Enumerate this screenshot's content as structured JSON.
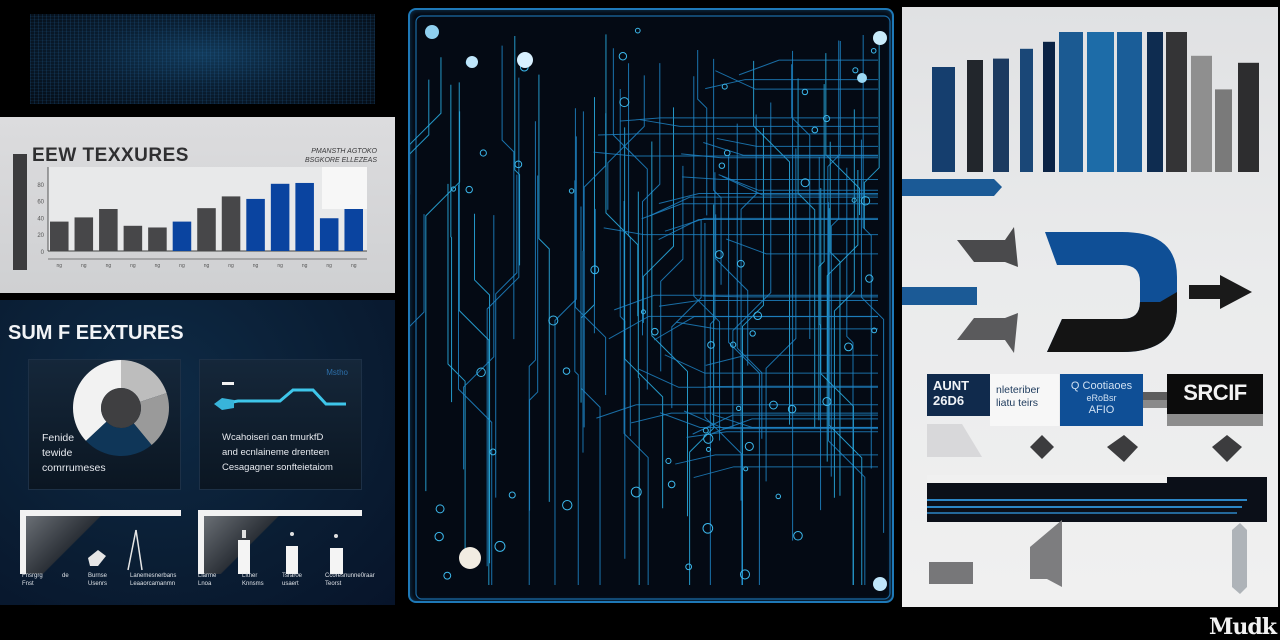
{
  "colors": {
    "accent_blue": "#0f4f96",
    "chart_blue": "#0a44a0",
    "chart_gray": "#474749",
    "circuit_trace": "#1e78b6",
    "circuit_bg": "#040a14",
    "dark_panel": "#0a1d33"
  },
  "banner": {
    "icon": "matrix-texture"
  },
  "chart_panel": {
    "title": "EEW TEXXURES",
    "legend_line1": "PMANSTH AGTOKO",
    "legend_line2": "BSGKORE ELLEZEAS"
  },
  "chart_data": {
    "type": "bar",
    "title": "EEW TEXXURES",
    "xlabel": "",
    "ylabel": "",
    "categories": [
      "ng",
      "ng",
      "ng",
      "ng",
      "ng",
      "ng",
      "ng",
      "ng",
      "ng",
      "ng",
      "ng",
      "ng",
      "ng"
    ],
    "y_tick_labels": [
      "0",
      "20",
      "40",
      "60",
      "80"
    ],
    "ylim": [
      0,
      100
    ],
    "series": [
      {
        "name": "gray",
        "color": "#474749",
        "values": [
          35,
          null,
          50,
          30,
          28,
          null,
          51,
          65,
          null,
          null,
          null,
          null,
          null
        ]
      },
      {
        "name": "blue",
        "color": "#0a44a0",
        "values": [
          null,
          null,
          null,
          null,
          null,
          35,
          null,
          null,
          62,
          80,
          81,
          39,
          50
        ]
      }
    ],
    "values": [
      35,
      40,
      50,
      30,
      28,
      35,
      51,
      65,
      62,
      80,
      81,
      39,
      50
    ],
    "bar_colors": [
      "gray",
      "gray",
      "gray",
      "gray",
      "gray",
      "blue",
      "gray",
      "gray",
      "blue",
      "blue",
      "blue",
      "blue",
      "blue"
    ],
    "grid": false,
    "legend": "top-right"
  },
  "summary_panel": {
    "title": "SUM F EEXTURES",
    "pie_card": {
      "text_lines": [
        "Fenide",
        "tewide",
        "comrrumeses"
      ],
      "pie_slices": [
        {
          "label": "white",
          "value": 37,
          "color": "#f2f2f2"
        },
        {
          "label": "light-gray",
          "value": 20,
          "color": "#bdbdbd"
        },
        {
          "label": "gray",
          "value": 19,
          "color": "#9a9a9a"
        },
        {
          "label": "dark-blue",
          "value": 24,
          "color": "#0f3658"
        }
      ]
    },
    "line_card": {
      "tag": "Mstho",
      "text_lines": [
        "Wcahoiseri oan tmurkfD",
        "and ecnlaineme drenteen",
        "Cesagagner sonfteietaiom"
      ]
    },
    "mini_labels": [
      {
        "line1": "Fnsrgrg",
        "line2": "Fnst"
      },
      {
        "line1": "de",
        "line2": ""
      },
      {
        "line1": "Burnse",
        "line2": "Usenrs"
      },
      {
        "line1": "Lanemesnerbans",
        "line2": "Leaaorcamanmn"
      },
      {
        "line1": "Liarme",
        "line2": "Lnoa"
      },
      {
        "line1": "Lftner",
        "line2": "Knnsms"
      },
      {
        "line1": "Tsrar0e",
        "line2": "usaert"
      },
      {
        "line1": "Ccoresnunne0raar",
        "line2": "Teorst"
      }
    ]
  },
  "right_panel": {
    "bars": [
      {
        "value": 75,
        "color": "#153e6e"
      },
      {
        "value": 80,
        "color": "#22262c"
      },
      {
        "value": 81,
        "color": "#1c3a60"
      },
      {
        "value": 88,
        "color": "#1a4777"
      },
      {
        "value": 93,
        "color": "#0b2345"
      },
      {
        "value": 100,
        "color": "#1b5a92"
      },
      {
        "value": 100,
        "color": "#1d6ca8"
      },
      {
        "value": 100,
        "color": "#1a5d98"
      },
      {
        "value": 100,
        "color": "#0e2c50"
      },
      {
        "value": 100,
        "color": "#343436"
      },
      {
        "value": 83,
        "color": "#8f8f8f"
      },
      {
        "value": 59,
        "color": "#7a7a7a"
      },
      {
        "value": 78,
        "color": "#2d2d2f"
      }
    ],
    "aunt_box": {
      "line1": "AUNT",
      "line2": "26D6"
    },
    "white_box": {
      "line1": "nleteriber",
      "line2": "liatu teirs"
    },
    "blue_box": {
      "line1": "Q Cootiaoes",
      "line2": "eRoBsr",
      "line3": "AFIO"
    },
    "srcif_label": "SRCIF"
  },
  "watermark": "Mudk"
}
